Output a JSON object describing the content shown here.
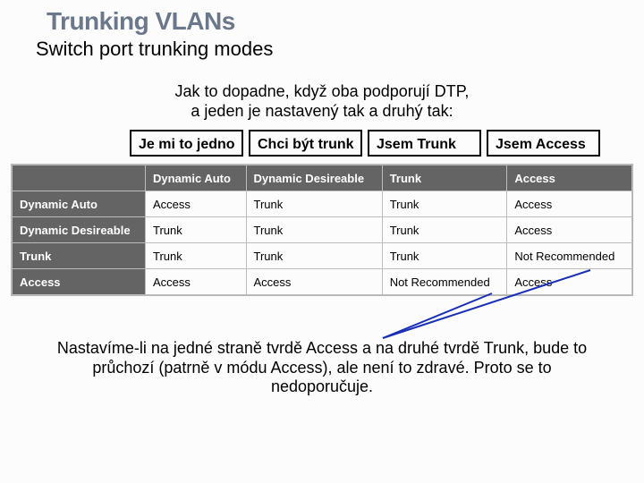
{
  "title": "Trunking VLANs",
  "subtitle": "Switch port trunking modes",
  "intro_l1": "Jak to dopadne, když oba podporují DTP,",
  "intro_l2": "a jeden je nastavený tak a druhý tak:",
  "mode_labels": [
    "Je mi to jedno",
    "Chci být trunk",
    "Jsem Trunk",
    "Jsem Access"
  ],
  "chart_data": {
    "type": "table",
    "title": "DTP trunking mode negotiation result matrix",
    "columns": [
      "Dynamic Auto",
      "Dynamic Desireable",
      "Trunk",
      "Access"
    ],
    "rows": [
      "Dynamic Auto",
      "Dynamic Desireable",
      "Trunk",
      "Access"
    ],
    "cells": [
      [
        "Access",
        "Trunk",
        "Trunk",
        "Access"
      ],
      [
        "Trunk",
        "Trunk",
        "Trunk",
        "Access"
      ],
      [
        "Trunk",
        "Trunk",
        "Trunk",
        "Not Recommended"
      ],
      [
        "Access",
        "Access",
        "Not Recommended",
        "Access"
      ]
    ]
  },
  "note_l1": "Nastavíme-li na jedné straně tvrdě Access a na druhé tvrdě Trunk, bude to",
  "note_l2": "průchozí (patrně v módu Access), ale není to zdravé. Proto se to",
  "note_l3": "nedoporučuje."
}
